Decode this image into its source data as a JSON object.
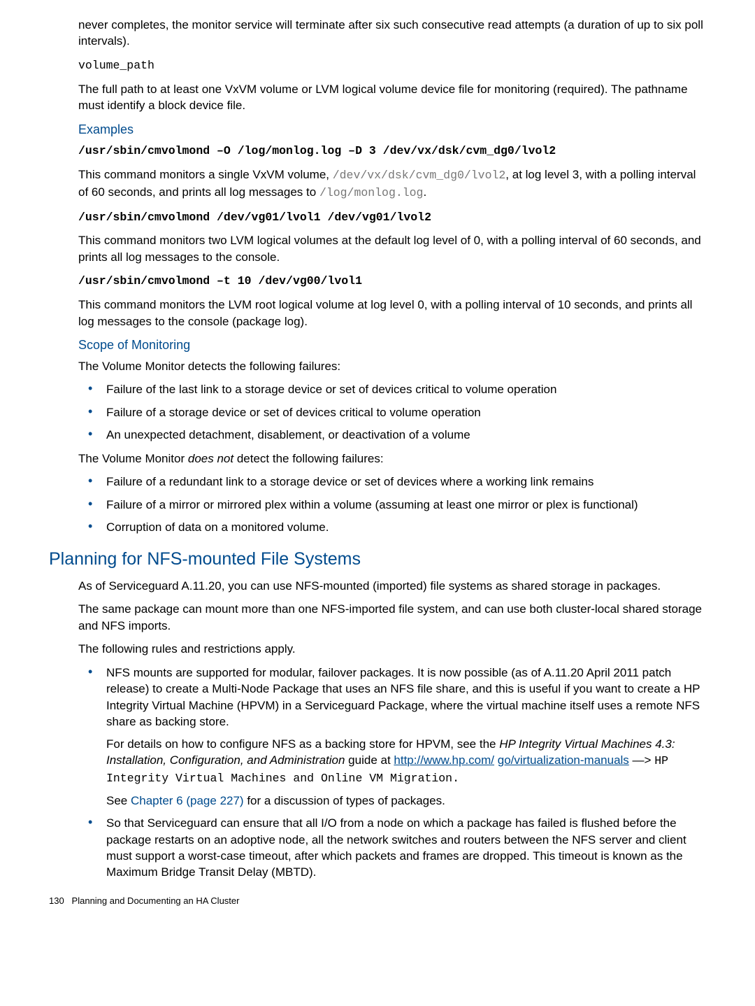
{
  "top": {
    "p1": "never completes, the monitor service will terminate after six such consecutive read attempts (a duration of up to six poll intervals).",
    "volpath": "volume_path",
    "p2": "The full path to at least one VxVM volume or LVM logical volume device file for monitoring (required). The pathname must identify a block device file."
  },
  "examples": {
    "heading": "Examples",
    "cmd1": "/usr/sbin/cmvolmond –O /log/monlog.log –D 3 /dev/vx/dsk/cvm_dg0/lvol2",
    "c1_a": "This command monitors a single VxVM volume, ",
    "c1_path": "/dev/vx/dsk/cvm_dg0/lvol2",
    "c1_b": ", at log level 3, with a polling interval of 60 seconds, and prints all log messages to ",
    "c1_log": "/log/monlog.log",
    "c1_c": ".",
    "cmd2": "/usr/sbin/cmvolmond /dev/vg01/lvol1 /dev/vg01/lvol2",
    "c2": "This command monitors two LVM logical volumes at the default log level of 0, with a polling interval of 60 seconds, and prints all log messages to the console.",
    "cmd3": "/usr/sbin/cmvolmond –t 10 /dev/vg00/lvol1",
    "c3": "This command monitors the LVM root logical volume at log level 0, with a polling interval of 10 seconds, and prints all log messages to the console (package log)."
  },
  "scope": {
    "heading": "Scope of Monitoring",
    "intro": "The Volume Monitor detects the following failures:",
    "d1": "Failure of the last link to a storage device or set of devices critical to volume operation",
    "d2": "Failure of a storage device or set of devices critical to volume operation",
    "d3": "An unexpected detachment, disablement, or deactivation of a volume",
    "transA": "The Volume Monitor ",
    "transI": "does not",
    "transB": " detect the following failures:",
    "n1": "Failure of a redundant link to a storage device or set of devices where a working link remains",
    "n2": "Failure of a mirror or mirrored plex within a volume (assuming at least one mirror or plex is functional)",
    "n3": "Corruption of data on a monitored volume."
  },
  "nfs": {
    "heading": "Planning for NFS-mounted File Systems",
    "p1": "As of Serviceguard A.11.20, you can use NFS-mounted (imported) file systems as shared storage in packages.",
    "p2": "The same package can mount more than one NFS-imported file system, and can use both cluster-local shared storage and NFS imports.",
    "p3": "The following rules and restrictions apply.",
    "li1a": "NFS mounts are supported for modular, failover packages. It is now possible (as of A.11.20 April 2011 patch release) to create a Multi-Node Package that uses an NFS file share, and this is useful if you want to create a HP Integrity Virtual Machine (HPVM) in a Serviceguard Package, where the virtual machine itself uses a remote NFS share as backing store.",
    "li1b_a": "For details on how to configure NFS as a backing store for HPVM, see the ",
    "li1b_i": "HP Integrity Virtual Machines 4.3: Installation, Configuration, and Administration",
    "li1b_b": " guide at ",
    "li1b_link1": "http://www.hp.com/",
    "li1b_link2": "go/virtualization-manuals",
    "li1b_arrow": " —> ",
    "li1b_mono": "HP Integrity Virtual Machines and Online VM Migration.",
    "li1c_a": "See ",
    "li1c_ref": "Chapter 6 (page 227)",
    "li1c_b": " for a discussion of types of packages.",
    "li2": "So that Serviceguard can ensure that all I/O from a node on which a package has failed is flushed before the package restarts on an adoptive node, all the network switches and routers between the NFS server and client must support a worst-case timeout, after which packets and frames are dropped. This timeout is known as the Maximum Bridge Transit Delay (MBTD)."
  },
  "footer": {
    "pg": "130",
    "chap": "Planning and Documenting an HA Cluster"
  }
}
